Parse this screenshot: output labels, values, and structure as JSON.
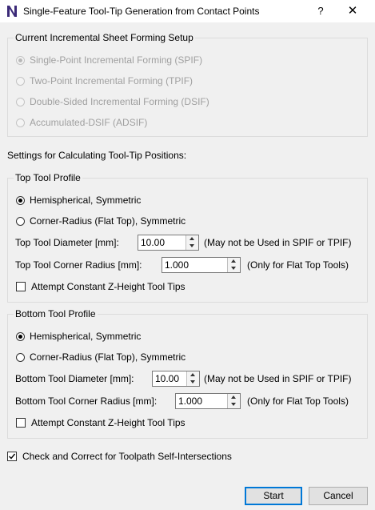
{
  "window": {
    "title": "Single-Feature Tool-Tip Generation from Contact Points",
    "help_label": "?",
    "close_label": "✕",
    "icon": "app-logo-n-icon",
    "icon_color": "#3b2a78"
  },
  "setup": {
    "title": "Current Incremental Sheet Forming Setup",
    "options": [
      {
        "label": "Single-Point Incremental Forming (SPIF)",
        "checked": true,
        "enabled": false
      },
      {
        "label": "Two-Point Incremental Forming (TPIF)",
        "checked": false,
        "enabled": false
      },
      {
        "label": "Double-Sided Incremental Forming (DSIF)",
        "checked": false,
        "enabled": false
      },
      {
        "label": "Accumulated-DSIF (ADSIF)",
        "checked": false,
        "enabled": false
      }
    ]
  },
  "settings_heading": "Settings for Calculating Tool-Tip Positions:",
  "top_tool": {
    "title": "Top Tool Profile",
    "options": [
      {
        "label": "Hemispherical, Symmetric",
        "checked": true
      },
      {
        "label": "Corner-Radius (Flat Top), Symmetric",
        "checked": false
      }
    ],
    "diameter_label": "Top Tool Diameter [mm]:",
    "diameter_value": "10.00",
    "diameter_note": "(May not be Used in SPIF or TPIF)",
    "radius_label": "Top Tool Corner Radius [mm]:",
    "radius_value": "1.000",
    "radius_note": "(Only for Flat Top Tools)",
    "constant_z_label": "Attempt Constant Z-Height Tool Tips",
    "constant_z_checked": false
  },
  "bottom_tool": {
    "title": "Bottom Tool Profile",
    "options": [
      {
        "label": "Hemispherical, Symmetric",
        "checked": true
      },
      {
        "label": "Corner-Radius (Flat Top), Symmetric",
        "checked": false
      }
    ],
    "diameter_label": "Bottom Tool Diameter [mm]:",
    "diameter_value": "10.00",
    "diameter_note": "(May not be Used in SPIF or TPIF)",
    "radius_label": "Bottom Tool Corner Radius [mm]:",
    "radius_value": "1.000",
    "radius_note": "(Only for Flat Top Tools)",
    "constant_z_label": "Attempt Constant Z-Height Tool Tips",
    "constant_z_checked": false
  },
  "self_intersection": {
    "label": "Check and Correct for Toolpath Self-Intersections",
    "checked": true
  },
  "buttons": {
    "start": "Start",
    "cancel": "Cancel"
  },
  "colors": {
    "accent": "#0078d7",
    "window_bg": "#f0f0f0",
    "disabled_text": "#a0a0a0"
  }
}
